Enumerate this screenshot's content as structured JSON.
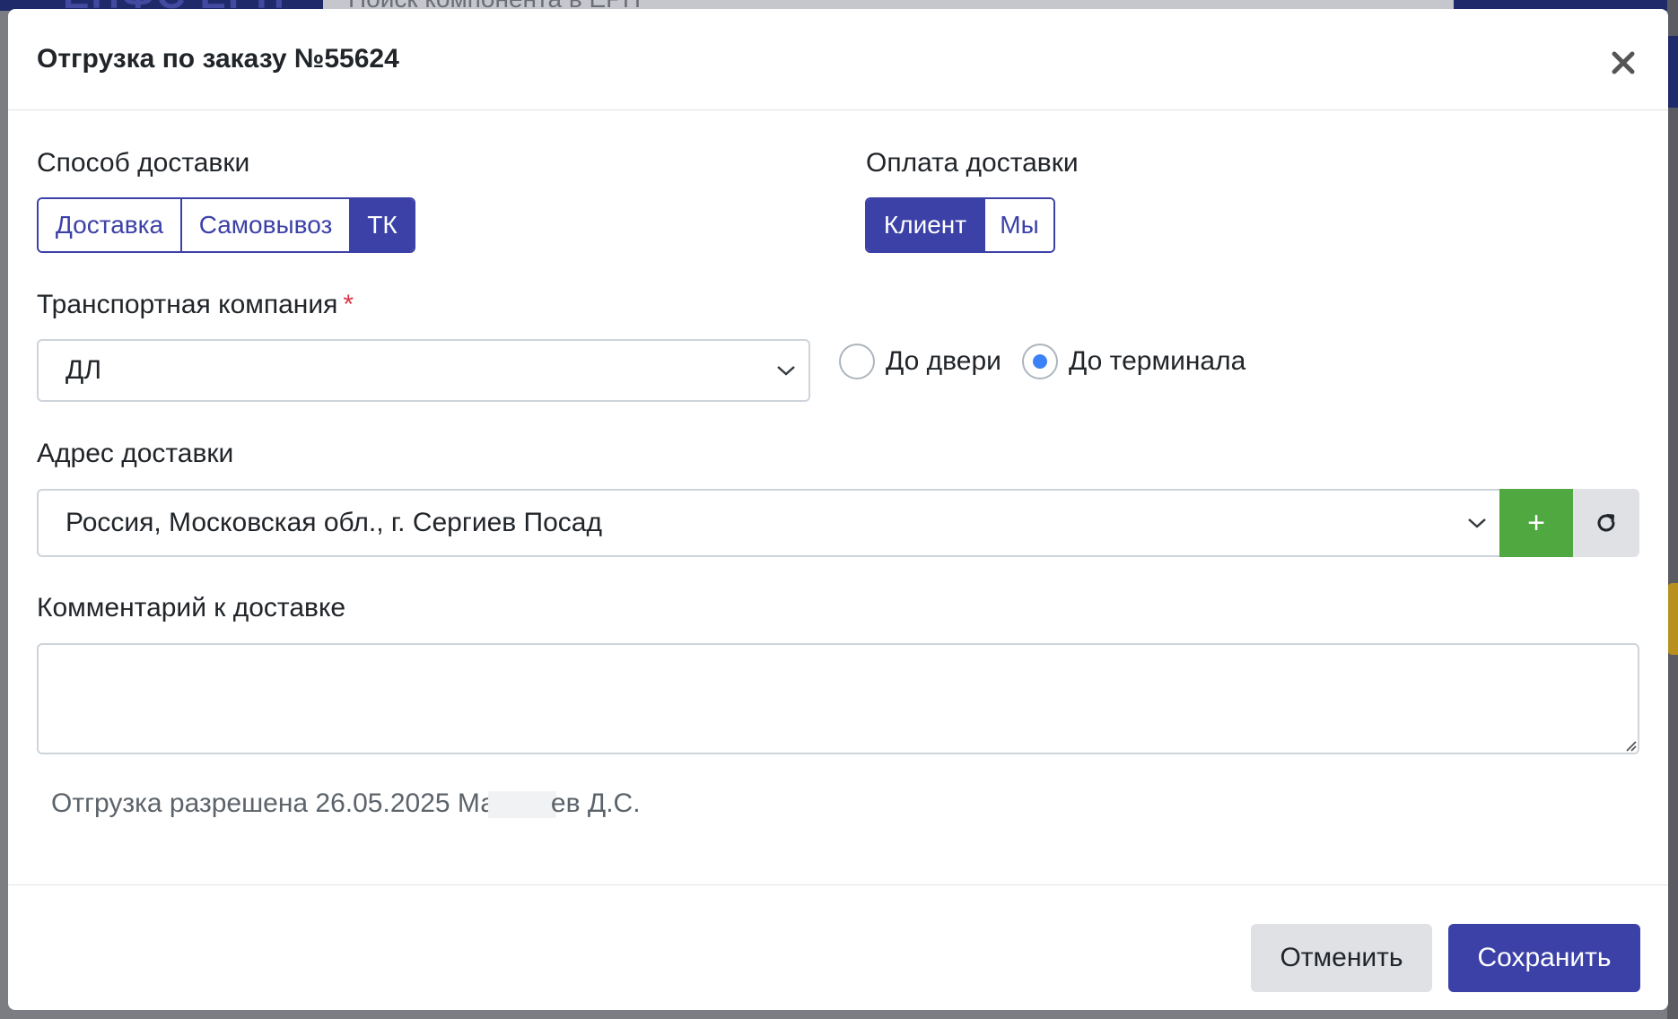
{
  "modal": {
    "title": "Отгрузка по заказу №55624"
  },
  "delivery_method": {
    "label": "Способ доставки",
    "options": [
      "Доставка",
      "Самовывоз",
      "ТК"
    ],
    "selected": "ТК"
  },
  "delivery_payment": {
    "label": "Оплата доставки",
    "options": [
      "Клиент",
      "Мы"
    ],
    "selected": "Клиент"
  },
  "transport_company": {
    "label": "Транспортная компания",
    "required_mark": "*",
    "value": "ДЛ"
  },
  "delivery_type": {
    "options": [
      "До двери",
      "До терминала"
    ],
    "selected": "До терминала"
  },
  "address": {
    "label": "Адрес доставки",
    "value": "Россия, Московская обл., г. Сергиев Посад",
    "add_symbol": "+"
  },
  "comment": {
    "label": "Комментарий к доставке",
    "value": ""
  },
  "info": {
    "prefix": "Отгрузка разрешена 26.05.2025 Ма",
    "suffix": "ев Д.С."
  },
  "footer": {
    "cancel_label": "Отменить",
    "save_label": "Сохранить"
  },
  "colors": {
    "primary": "#3c41a8",
    "success": "#4fa840",
    "radio_checked": "#3b82f6",
    "required": "#dc3545"
  },
  "background": {
    "logo_text": "ЕПФС ЕРП",
    "search_placeholder": "Поиск компонента в ЕРП"
  }
}
